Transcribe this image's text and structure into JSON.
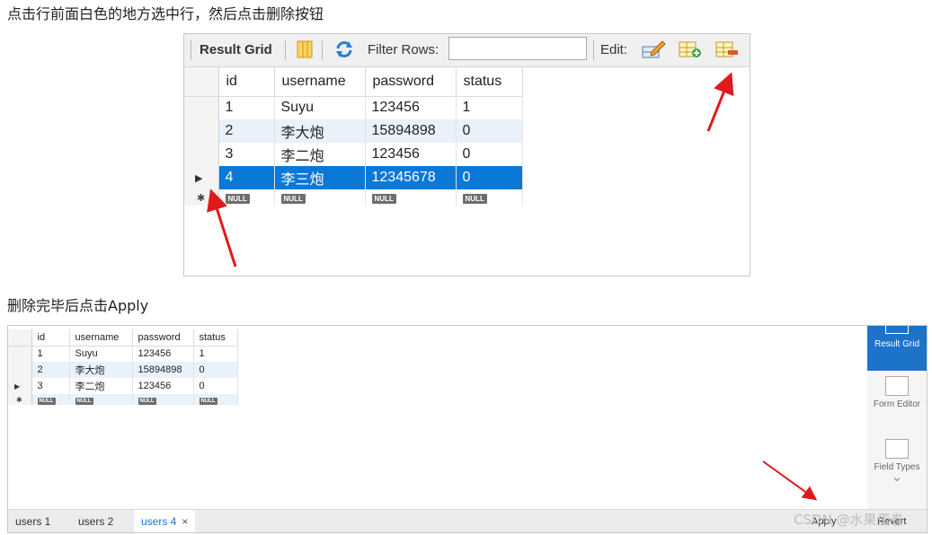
{
  "captions": {
    "step1": "点击行前面白色的地方选中行，然后点击删除按钮",
    "step2": "删除完毕后点击Apply"
  },
  "shot1": {
    "toolbar": {
      "result_grid": "Result Grid",
      "filter_label": "Filter Rows:",
      "filter_value": "",
      "edit_label": "Edit:"
    },
    "columns": [
      "id",
      "username",
      "password",
      "status"
    ],
    "rows": [
      [
        "1",
        "Suyu",
        "123456",
        "1"
      ],
      [
        "2",
        "李大炮",
        "15894898",
        "0"
      ],
      [
        "3",
        "李二炮",
        "123456",
        "0"
      ],
      [
        "4",
        "李三炮",
        "12345678",
        "0"
      ]
    ],
    "selected_row_index": 3,
    "null_label": "NULL"
  },
  "shot2": {
    "columns": [
      "id",
      "username",
      "password",
      "status"
    ],
    "rows": [
      [
        "1",
        "Suyu",
        "123456",
        "1"
      ],
      [
        "2",
        "李大炮",
        "15894898",
        "0"
      ],
      [
        "3",
        "李二炮",
        "123456",
        "0"
      ]
    ],
    "null_label": "NULL",
    "tabs": [
      {
        "label": "users 1",
        "active": false
      },
      {
        "label": "users 2",
        "active": false
      },
      {
        "label": "users 4",
        "active": true
      }
    ],
    "tab_close": "×",
    "apply_label": "Apply",
    "revert_label": "Revert",
    "side_panel": [
      {
        "label": "Result Grid",
        "active": true
      },
      {
        "label": "Form Editor",
        "active": false
      },
      {
        "label": "Field Types",
        "active": false
      }
    ]
  },
  "watermark": "CSDN @水果蛋卷",
  "colors": {
    "selection": "#0a78d7",
    "alt_row": "#e9f1fb",
    "arrow": "#e0191b",
    "side_active": "#1d73c8"
  }
}
